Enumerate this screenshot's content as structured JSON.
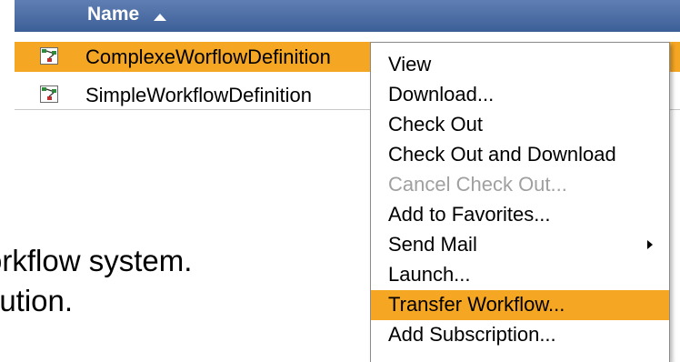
{
  "list": {
    "header": {
      "label": "Name"
    },
    "rows": [
      {
        "label": "ComplexeWorflowDefinition",
        "icon": "workflow-definition-icon",
        "selected": true
      },
      {
        "label": "SimpleWorkflowDefinition",
        "icon": "workflow-definition-icon",
        "selected": false
      }
    ]
  },
  "background_text": {
    "line1": "orkflow system.",
    "line2": "lution."
  },
  "context_menu": {
    "items": [
      {
        "label": "View",
        "disabled": false
      },
      {
        "label": "Download...",
        "disabled": false
      },
      {
        "label": "Check Out",
        "disabled": false
      },
      {
        "label": "Check Out and Download",
        "disabled": false
      },
      {
        "label": "Cancel Check Out...",
        "disabled": true
      },
      {
        "label": "Add to Favorites...",
        "disabled": false
      },
      {
        "label": "Send Mail",
        "disabled": false,
        "has_submenu": true
      },
      {
        "label": "Launch...",
        "disabled": false
      },
      {
        "label": "Transfer Workflow...",
        "disabled": false,
        "highlighted": true
      },
      {
        "label": "Add Subscription...",
        "disabled": false
      }
    ]
  },
  "colors": {
    "header_bg": "#3d5f98",
    "selection": "#f5a623",
    "disabled_text": "#a0a0a0"
  }
}
